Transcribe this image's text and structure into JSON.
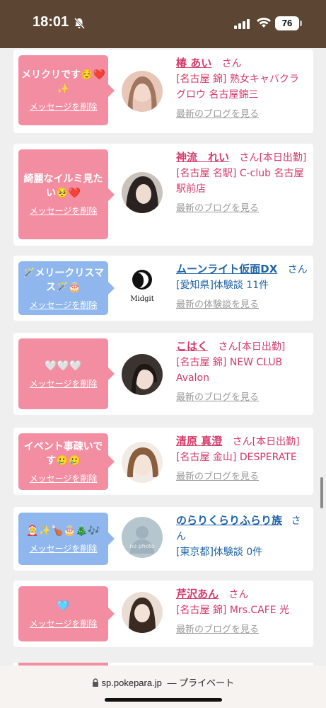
{
  "status_bar": {
    "time": "18:01",
    "battery": "76"
  },
  "url_bar": {
    "domain": "sp.pokepara.jp",
    "privacy": "— プライベート"
  },
  "common": {
    "delete_label": "メッセージを削除",
    "honorific": "さん"
  },
  "cards": [
    {
      "message": "メリクリです☺️❤️✨",
      "name": "椿 あい",
      "suffix": "さん",
      "shop": "[名古屋 錦] 熟女キャバクラ グロウ 名古屋錦三",
      "link": "最新のブログを見る"
    },
    {
      "message": "綺麗なイルミ見たい🥺❤️",
      "name": "神流　れい",
      "suffix": "さん[本日出勤]",
      "shop": "[名古屋 名駅] C-club 名古屋駅前店",
      "link": "最新のブログを見る"
    },
    {
      "message": "🪄メリークリスマス🪄🎂",
      "name": "ムーンライト仮面DX",
      "suffix": "さん",
      "shop": "[愛知県]体験談 11件",
      "link": "最新の体験談を見る",
      "logo_text": "Midgit"
    },
    {
      "message": "🤍🤍🤍",
      "name": "こはく",
      "suffix": "さん[本日出勤]",
      "shop": "[名古屋 錦] NEW CLUB Avalon",
      "link": "最新のブログを見る"
    },
    {
      "message": "イベント事疎いです🥲🥲",
      "name": "清原 真澄",
      "suffix": "さん[本日出勤]",
      "shop": "[名古屋 金山] DESPERATE",
      "link": "最新のブログを見る"
    },
    {
      "message": "🤶✨🍗🎂🎄🎶",
      "name": "のらりくらりふらり族",
      "suffix": "さん",
      "shop": "[東京都]体験談 0件",
      "link": "",
      "no_photo": "no photo"
    },
    {
      "message": "🩵",
      "name": "芹沢あん",
      "suffix": "さん",
      "shop": "[名古屋 錦] Mrs.CAFE 光",
      "link": "最新のブログを見る"
    }
  ]
}
